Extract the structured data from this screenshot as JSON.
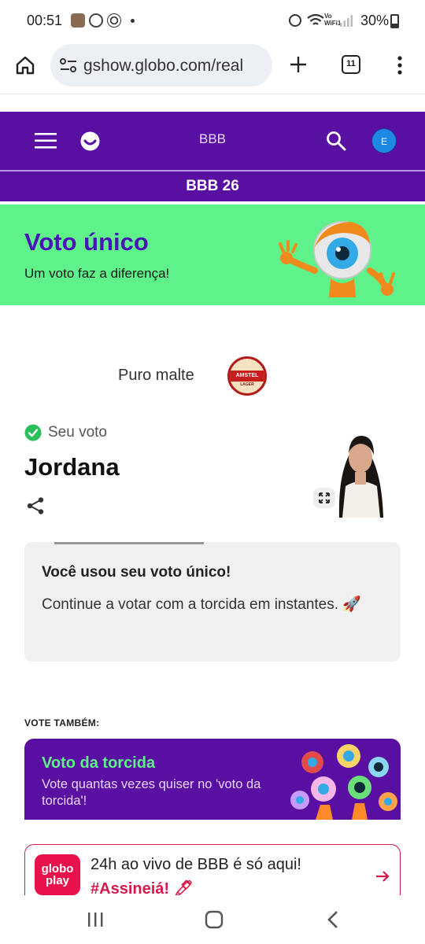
{
  "status_bar": {
    "time": "00:51",
    "wifi_label_1": "Vo",
    "wifi_label_2": "WiFi1",
    "battery": "30%"
  },
  "browser": {
    "url": "gshow.globo.com/real",
    "tab_count": "11"
  },
  "site_header": {
    "title": "BBB",
    "avatar_letter": "E",
    "section": "BBB 26"
  },
  "banner": {
    "title": "Voto único",
    "subtitle": "Um voto faz a diferença!"
  },
  "sponsor": {
    "label": "Puro malte",
    "brand": "AMSTEL",
    "brand_sub": "LAGER"
  },
  "vote": {
    "status": "Seu voto",
    "name": "Jordana"
  },
  "message": {
    "title": "Você usou seu voto único!",
    "body": "Continue a votar com a torcida em instantes. 🚀"
  },
  "also_vote": {
    "heading": "VOTE TAMBÉM:",
    "card_title": "Voto da torcida",
    "card_body": "Vote quantas vezes quiser no 'voto da torcida'!"
  },
  "promo": {
    "logo_line1": "globo",
    "logo_line2": "play",
    "text": "24h ao vivo de BBB é só aqui!",
    "cta": "#Assineiá! 🖊"
  },
  "colors": {
    "purple": "#5a0fa3",
    "green": "#5ff28a",
    "accent_red": "#d31a4b",
    "avatar_blue": "#1e88e5"
  }
}
